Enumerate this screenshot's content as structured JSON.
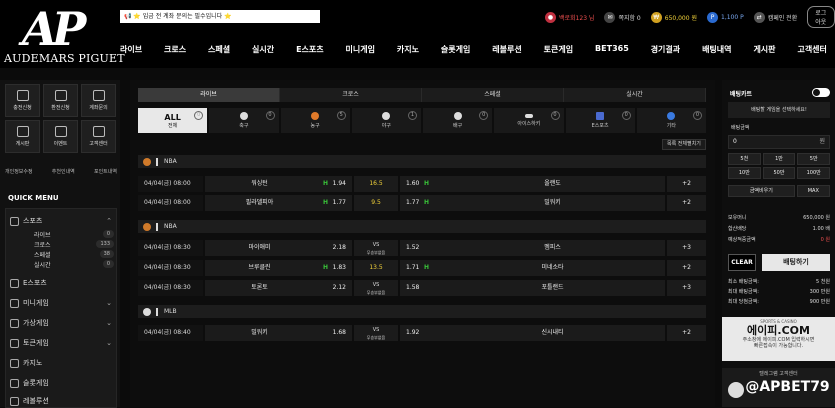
{
  "header": {
    "logo_mark": "AP",
    "logo_text": "AUDEMARS PIGUET",
    "notice": "📢 ⭐ 입금 전 계좌 문의는 필수입니다 ⭐",
    "user": "백로회123 님",
    "messages": "쪽지함 0",
    "money": "650,000 원",
    "points": "1,100 P",
    "transfer": "캠페인 전환",
    "logout": "로그아웃"
  },
  "nav": [
    "라이브",
    "크로스",
    "스페셜",
    "실시간",
    "E스포츠",
    "미니게임",
    "카지노",
    "슬롯게임",
    "레볼루션",
    "토큰게임",
    "BET365",
    "경기결과",
    "배팅내역",
    "게시판",
    "고객센터"
  ],
  "left": {
    "quick_buttons": [
      "충전신청",
      "환전신청",
      "계좌문의",
      "게시판",
      "이벤트",
      "고객센터"
    ],
    "links": [
      "개인정보수정",
      "추천인내역",
      "포인트내역"
    ],
    "quick_title": "QUICK MENU",
    "menu": {
      "sports": "스포츠",
      "sub": [
        {
          "name": "라이브",
          "count": "0"
        },
        {
          "name": "크로스",
          "count": "133"
        },
        {
          "name": "스페셜",
          "count": "38"
        },
        {
          "name": "실시간",
          "count": "0"
        }
      ],
      "items": [
        "E스포츠",
        "미니게임",
        "가상게임",
        "토큰게임",
        "카지노",
        "슬롯게임",
        "레볼루션"
      ]
    }
  },
  "center": {
    "tabs": [
      "라이브",
      "크로스",
      "스페셜",
      "실시간"
    ],
    "sports": [
      {
        "label": "ALL",
        "sub": "전체",
        "count": "0"
      },
      {
        "label": "축구",
        "count": "0"
      },
      {
        "label": "농구",
        "count": "5"
      },
      {
        "label": "야구",
        "count": "1"
      },
      {
        "label": "배구",
        "count": "0"
      },
      {
        "label": "아이스하키",
        "count": "0"
      },
      {
        "label": "E스포츠",
        "count": "0"
      },
      {
        "label": "기타",
        "count": "0"
      }
    ],
    "close_all": "목록 전체펼치기",
    "leagues": [
      {
        "name": "NBA",
        "rows": [
          {
            "time": "04/04(금) 08:00",
            "home": "워싱턴",
            "hflag": "H",
            "hodd": "1.94",
            "mid": "16.5",
            "aodd": "1.60",
            "aflag": "H",
            "away": "올랜도",
            "more": "+2"
          },
          {
            "time": "04/04(금) 08:00",
            "home": "필라델피아",
            "hflag": "H",
            "hodd": "1.77",
            "mid": "9.5",
            "aodd": "1.77",
            "aflag": "H",
            "away": "밀워키",
            "more": "+2"
          }
        ]
      },
      {
        "name": "NBA",
        "rows": [
          {
            "time": "04/04(금) 08:30",
            "home": "마이애미",
            "hflag": "",
            "hodd": "2.18",
            "mid": "VS",
            "aodd": "1.52",
            "aflag": "",
            "away": "멤피스",
            "more": "+3"
          },
          {
            "time": "04/04(금) 08:30",
            "home": "브루클린",
            "hflag": "H",
            "hodd": "1.83",
            "mid": "13.5",
            "aodd": "1.71",
            "aflag": "H",
            "away": "미네소타",
            "more": "+2"
          },
          {
            "time": "04/04(금) 08:30",
            "home": "토론토",
            "hflag": "",
            "hodd": "2.12",
            "mid": "VS",
            "aodd": "1.58",
            "aflag": "",
            "away": "포틀랜드",
            "more": "+3"
          }
        ]
      },
      {
        "name": "MLB",
        "rows": [
          {
            "time": "04/04(금) 08:40",
            "home": "밀워키",
            "hflag": "",
            "hodd": "1.68",
            "mid": "VS",
            "aodd": "1.92",
            "aflag": "",
            "away": "신시내티",
            "more": "+2"
          }
        ]
      }
    ],
    "vs_sub": "무승부없음"
  },
  "right": {
    "title": "배팅카트",
    "message": "배팅할 게임을 선택하세요!",
    "amount_label": "배팅금액",
    "amount": "0",
    "x": "원",
    "amounts": [
      "5천",
      "1만",
      "5만",
      "10만",
      "50만",
      "100만"
    ],
    "reset": "금액비우기",
    "max": "MAX",
    "info": [
      {
        "k": "보유머니",
        "v": "650,000 원"
      },
      {
        "k": "합산배당",
        "v": "1.00 배"
      },
      {
        "k": "예상적중금액",
        "v": "0 원"
      }
    ],
    "clear": "CLEAR",
    "bet": "배팅하기",
    "limits": [
      {
        "k": "최소 배팅금액:",
        "v": "5 천원"
      },
      {
        "k": "최대 배팅금액:",
        "v": "300 만원"
      },
      {
        "k": "최대 당첨금액:",
        "v": "900 만원"
      }
    ],
    "promo1": {
      "small": "SPORTS & CASINO",
      "big": "에이피.COM",
      "desc1": "주소창에 에이피.COM 입력하시면",
      "desc2": "빠른접속이 가능합니다."
    },
    "promo2": {
      "small": "텔레그램 고객센터",
      "handle": "@APBET79"
    }
  }
}
